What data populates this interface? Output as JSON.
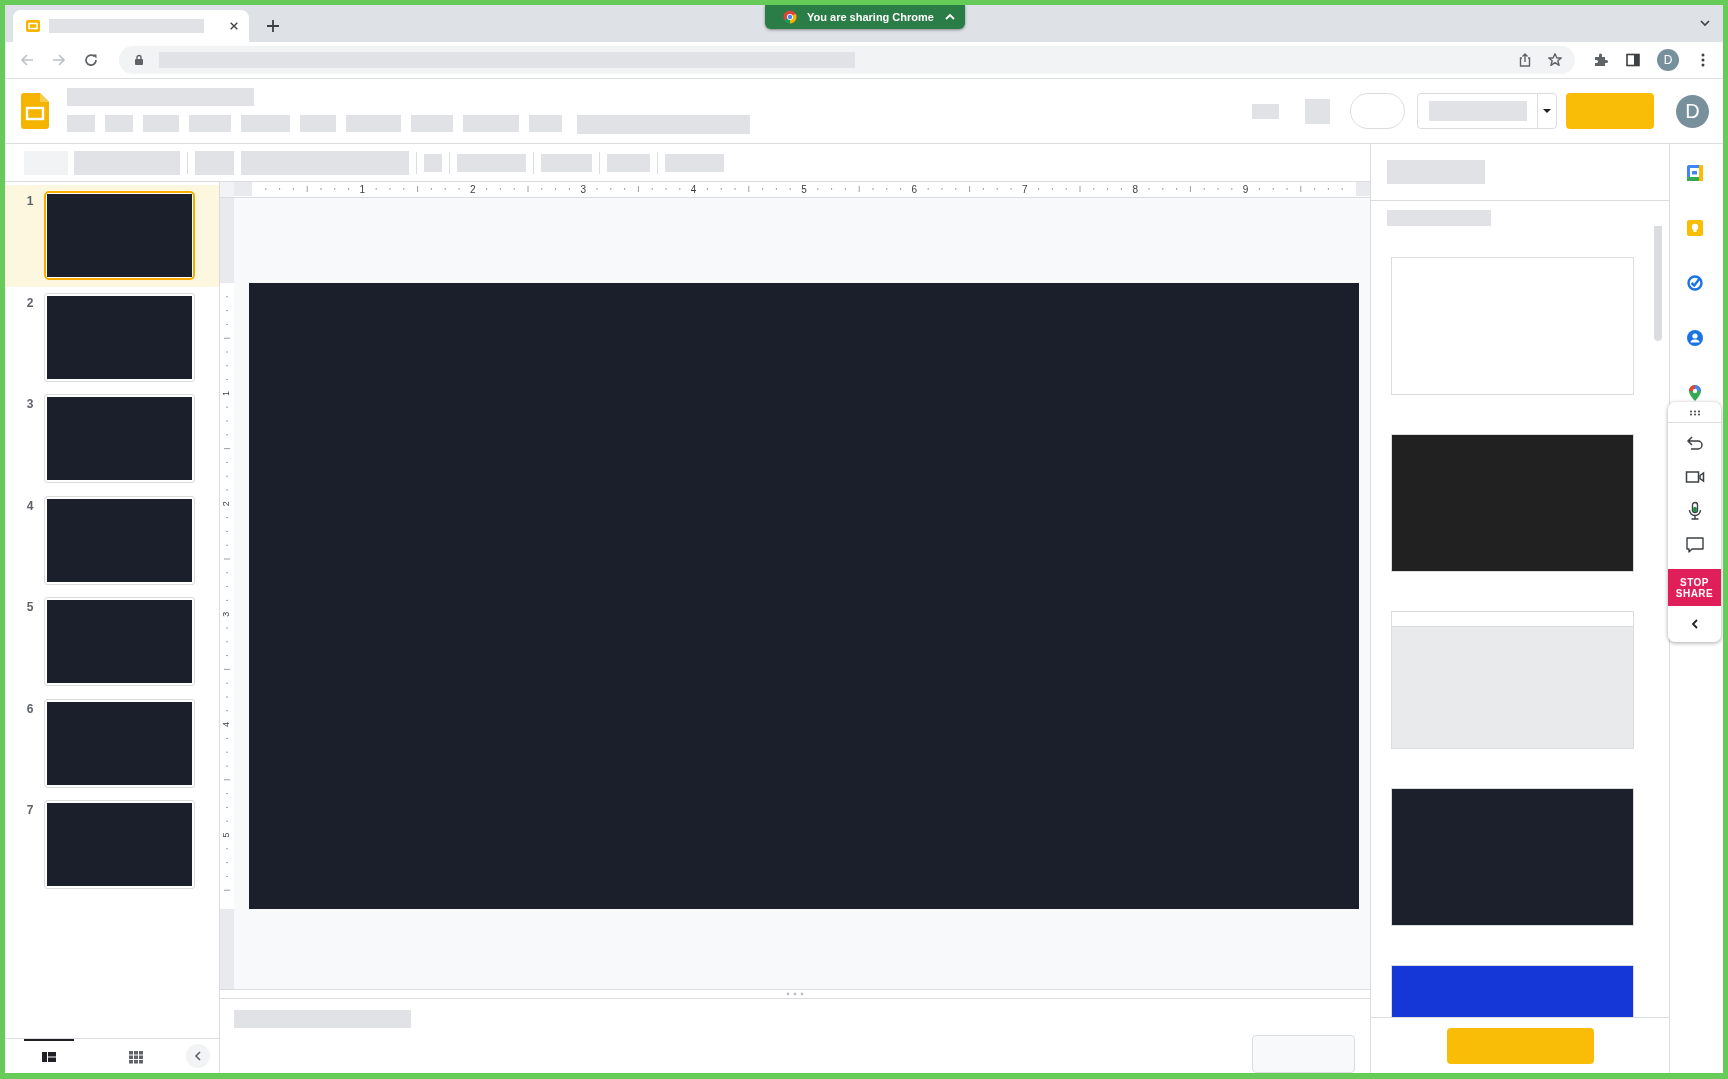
{
  "browser": {
    "sharing_banner": "You are sharing Chrome",
    "profile_initial": "D"
  },
  "app": {
    "account_initial": "D"
  },
  "ruler": {
    "horizontal": [
      "1",
      "2",
      "3",
      "4",
      "5",
      "6",
      "7",
      "8",
      "9"
    ],
    "vertical": [
      "1",
      "2",
      "3",
      "4",
      "5"
    ]
  },
  "slides": [
    {
      "number": "1",
      "selected": true
    },
    {
      "number": "2",
      "selected": false
    },
    {
      "number": "3",
      "selected": false
    },
    {
      "number": "4",
      "selected": false
    },
    {
      "number": "5",
      "selected": false
    },
    {
      "number": "6",
      "selected": false
    },
    {
      "number": "7",
      "selected": false
    }
  ],
  "view_toggle": [
    {
      "kind": "list",
      "selected": true
    },
    {
      "kind": "grid",
      "selected": false
    }
  ],
  "themes": [
    {
      "kind": "plain",
      "color": "#ffffff"
    },
    {
      "kind": "plain",
      "color": "#212121"
    },
    {
      "kind": "banded",
      "color": "#e8eaeb"
    },
    {
      "kind": "plain",
      "color": "#1b202c"
    },
    {
      "kind": "plain",
      "color": "#1637d8"
    }
  ],
  "meet_panel": {
    "stop_share": "STOP SHARE"
  }
}
